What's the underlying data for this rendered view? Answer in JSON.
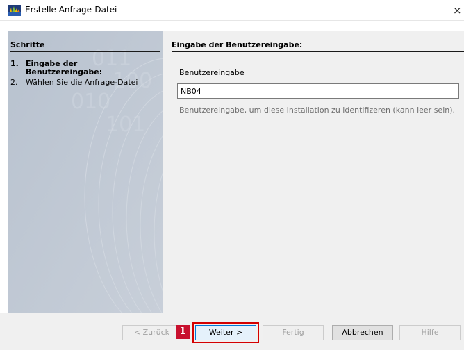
{
  "window": {
    "title": "Erstelle Anfrage-Datei",
    "close_glyph": "×"
  },
  "steps": {
    "header": "Schritte",
    "items": [
      {
        "number": "1.",
        "label_line1": "Eingabe der",
        "label_line2": "Benutzereingabe:",
        "active": true
      },
      {
        "number": "2.",
        "label_line1": "Wählen Sie die Anfrage-Datei",
        "active": false
      }
    ]
  },
  "content": {
    "header": "Eingabe der Benutzereingabe:",
    "field_label": "Benutzereingabe",
    "field_value": "NB04",
    "field_hint": "Benutzereingabe, um diese Installation zu identifizeren (kann leer sein)."
  },
  "buttons": {
    "back": "< Zurück",
    "next": "Weiter >",
    "finish": "Fertig",
    "cancel": "Abbrechen",
    "help": "Hilfe"
  },
  "annotation": {
    "marker_number": "1",
    "marker_color": "#c8102e",
    "highlight_color": "#d40000"
  },
  "icons": {
    "app": "app-logo-icon",
    "close": "close-icon"
  }
}
